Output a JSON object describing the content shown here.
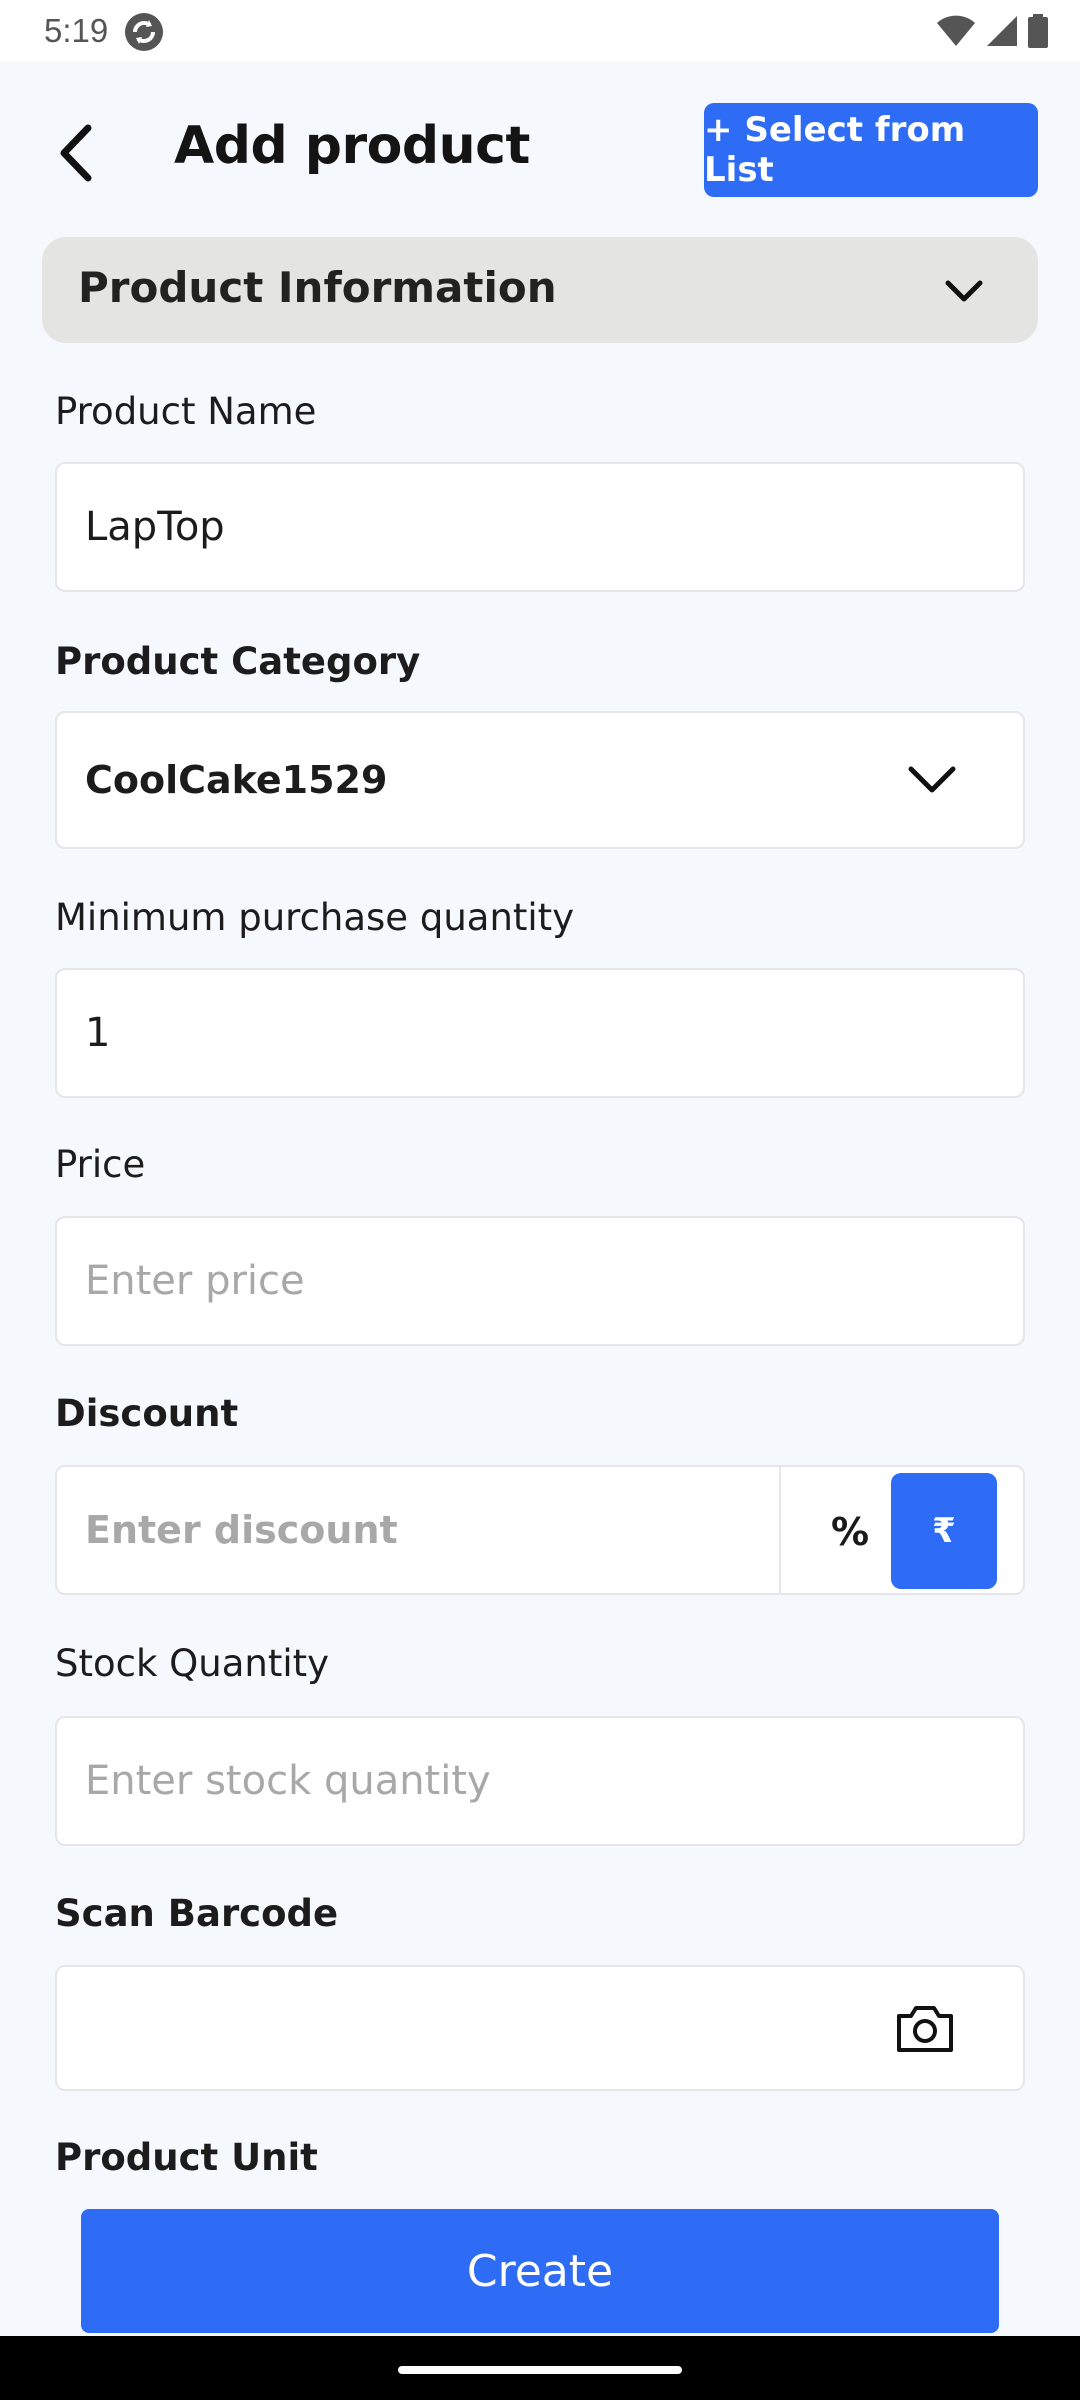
{
  "status_bar": {
    "time": "5:19",
    "icons": [
      "sync-icon",
      "wifi-icon",
      "signal-icon",
      "battery-icon"
    ]
  },
  "header": {
    "back_icon": "back-arrow-icon",
    "title": "Add product",
    "select_from_list_label": "+ Select from List"
  },
  "section": {
    "title": "Product Information",
    "chevron_icon": "chevron-down-icon"
  },
  "fields": {
    "product_name": {
      "label": "Product Name",
      "value": "LapTop"
    },
    "product_category": {
      "label": "Product Category",
      "value": "CoolCake1529"
    },
    "min_qty": {
      "label": "Minimum purchase quantity",
      "value": "1"
    },
    "price": {
      "label": "Price",
      "placeholder": "Enter price"
    },
    "discount": {
      "label": "Discount",
      "placeholder": "Enter discount",
      "percent_label": "%",
      "rupee_label": "₹"
    },
    "stock_qty": {
      "label": "Stock Quantity",
      "placeholder": "Enter stock quantity"
    },
    "barcode": {
      "label": "Scan Barcode",
      "icon": "camera-icon"
    },
    "product_unit": {
      "label": "Product Unit"
    }
  },
  "actions": {
    "create_label": "Create"
  },
  "colors": {
    "accent": "#2f6cf6",
    "background": "#f5f8fc",
    "section_bg": "#e4e5e2"
  }
}
